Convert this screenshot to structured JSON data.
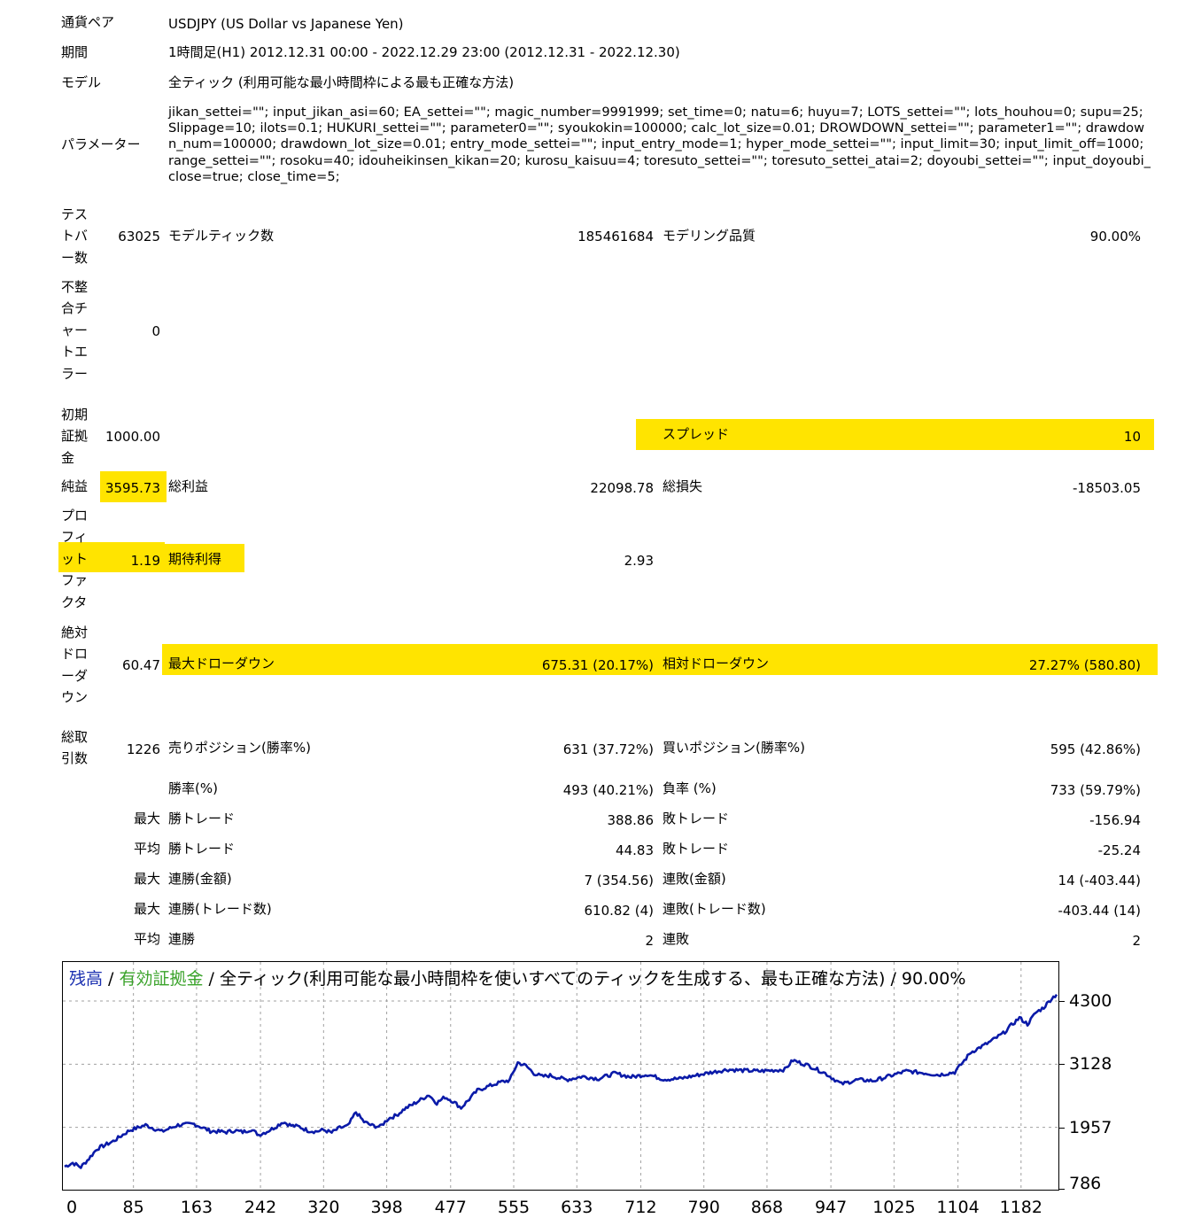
{
  "report": {
    "pair_label": "通貨ペア",
    "pair_value": "USDJPY (US Dollar vs Japanese Yen)",
    "period_label": "期間",
    "period_value": "1時間足(H1) 2012.12.31 00:00 - 2022.12.29 23:00 (2012.12.31 - 2022.12.30)",
    "model_label": "モデル",
    "model_value": "全ティック (利用可能な最小時間枠による最も正確な方法)",
    "params_label": "パラメーター",
    "params_value": "jikan_settei=\"\"; input_jikan_asi=60; EA_settei=\"\"; magic_number=9991999; set_time=0; natu=6; huyu=7; LOTS_settei=\"\"; lots_houhou=0; supu=25; Slippage=10; ilots=0.1; HUKURI_settei=\"\"; parameter0=\"\"; syoukokin=100000; calc_lot_size=0.01; DROWDOWN_settei=\"\"; parameter1=\"\"; drawdown_num=100000; drawdown_lot_size=0.01; entry_mode_settei=\"\"; input_entry_mode=1; hyper_mode_settei=\"\"; input_limit=30; input_limit_off=1000; range_settei=\"\"; rosoku=40; idouheikinsen_kikan=20; kurosu_kaisuu=4; toresuto_settei=\"\"; toresuto_settei_atai=2; doyoubi_settei=\"\"; input_doyoubi_close=true; close_time=5;"
  },
  "stats": {
    "bars_label": "テストバー数",
    "bars_value": "63025",
    "ticks_label": "モデルティック数",
    "ticks_value": "185461684",
    "quality_label": "モデリング品質",
    "quality_value": "90.00%",
    "mismatch_label": "不整合チャートエラー",
    "mismatch_value": "0",
    "deposit_label": "初期証拠金",
    "deposit_value": "1000.00",
    "spread_label": "スプレッド",
    "spread_value": "10",
    "net_label": "純益",
    "net_value": "3595.73",
    "gross_profit_label": "総利益",
    "gross_profit_value": "22098.78",
    "gross_loss_label": "総損失",
    "gross_loss_value": "-18503.05",
    "pf_label": "プロフィットファクタ",
    "pf_value": "1.19",
    "expected_label": "期待利得",
    "expected_value": "2.93",
    "abs_dd_label": "絶対ドローダウン",
    "abs_dd_value": "60.47",
    "max_dd_label": "最大ドローダウン",
    "max_dd_value": "675.31 (20.17%)",
    "rel_dd_label": "相対ドローダウン",
    "rel_dd_value": "27.27% (580.80)",
    "trades_label": "総取引数",
    "trades_value": "1226",
    "short_label": "売りポジション(勝率%)",
    "short_value": "631 (37.72%)",
    "long_label": "買いポジション(勝率%)",
    "long_value": "595 (42.86%)",
    "win_rate_label": "勝率(%)",
    "win_rate_value": "493 (40.21%)",
    "loss_rate_label": "負率 (%)",
    "loss_rate_value": "733 (59.79%)",
    "max_label": "最大",
    "avg_label": "平均",
    "max_win_label": "勝トレード",
    "max_win_value": "388.86",
    "max_loss_label": "敗トレード",
    "max_loss_value": "-156.94",
    "avg_win_label": "勝トレード",
    "avg_win_value": "44.83",
    "avg_loss_label": "敗トレード",
    "avg_loss_value": "-25.24",
    "max_cons_win_label": "連勝(金額)",
    "max_cons_win_value": "7 (354.56)",
    "max_cons_loss_label": "連敗(金額)",
    "max_cons_loss_value": "14 (-403.44)",
    "max_cons_win_n_label": "連勝(トレード数)",
    "max_cons_win_n_value": "610.82 (4)",
    "max_cons_loss_n_label": "連敗(トレード数)",
    "max_cons_loss_n_value": "-403.44 (14)",
    "avg_cons_win_label": "連勝",
    "avg_cons_win_value": "2",
    "avg_cons_loss_label": "連敗",
    "avg_cons_loss_value": "2"
  },
  "chart_title": {
    "balance": "残高",
    "sep1": " / ",
    "equity": "有効証拠金",
    "rest": " / 全ティック(利用可能な最小時間枠を使いすべてのティックを生成する、最も正確な方法) / 90.00%"
  },
  "colors": {
    "highlight": "#ffe400",
    "balance_line": "#0a1aa8",
    "equity_text": "#3aa32a",
    "balance_text": "#1a2fb0"
  },
  "chart_data": {
    "type": "line",
    "title": "残高 / 有効証拠金 / 全ティック(利用可能な最小時間枠を使いすべてのティックを生成する、最も正確な方法) / 90.00%",
    "xlabel": "",
    "ylabel": "",
    "x_ticks": [
      "0",
      "85",
      "163",
      "242",
      "320",
      "398",
      "477",
      "555",
      "633",
      "712",
      "790",
      "868",
      "947",
      "1025",
      "1104",
      "1182"
    ],
    "y_ticks": [
      "4300",
      "3128",
      "1957",
      "786"
    ],
    "xlim": [
      0,
      1226
    ],
    "ylim": [
      786,
      4300
    ],
    "grid": true,
    "series": [
      {
        "values_x": [
          0,
          10,
          20,
          30,
          40,
          60,
          80,
          100,
          120,
          140,
          160,
          180,
          200,
          210,
          220,
          230,
          240,
          250,
          260,
          270,
          280,
          290,
          300,
          310,
          320,
          330,
          340,
          350,
          360,
          370,
          380,
          390,
          400,
          410,
          420,
          430,
          440,
          450,
          460,
          470,
          480,
          490,
          500,
          510,
          520,
          530,
          540,
          550,
          560,
          570,
          580,
          590,
          600,
          620,
          640,
          660,
          680,
          700,
          720,
          740,
          760,
          780,
          800,
          820,
          840,
          860,
          880,
          890,
          900,
          920,
          940,
          960,
          980,
          1000,
          1020,
          1040,
          1060,
          1080,
          1100,
          1110,
          1120,
          1140,
          1160,
          1170,
          1180,
          1190,
          1200,
          1210,
          1220,
          1226
        ],
        "values_y": [
          1230,
          1300,
          1220,
          1380,
          1560,
          1700,
          1900,
          2000,
          1880,
          2000,
          2020,
          1890,
          1870,
          1900,
          1870,
          1920,
          1820,
          1880,
          1960,
          2060,
          1990,
          1970,
          1900,
          1880,
          1910,
          1860,
          1950,
          1980,
          2240,
          2060,
          1990,
          1970,
          2120,
          2180,
          2300,
          2380,
          2470,
          2560,
          2410,
          2520,
          2440,
          2320,
          2480,
          2640,
          2700,
          2750,
          2800,
          2830,
          3160,
          3100,
          2960,
          2900,
          2920,
          2840,
          2900,
          2860,
          2960,
          2890,
          2940,
          2850,
          2860,
          2920,
          2980,
          3030,
          3010,
          3000,
          3020,
          3030,
          3200,
          3100,
          2960,
          2760,
          2840,
          2820,
          2910,
          3000,
          2970,
          2930,
          2980,
          3160,
          3350,
          3510,
          3700,
          3850,
          3990,
          3870,
          4080,
          4180,
          4350,
          4420
        ]
      }
    ]
  }
}
